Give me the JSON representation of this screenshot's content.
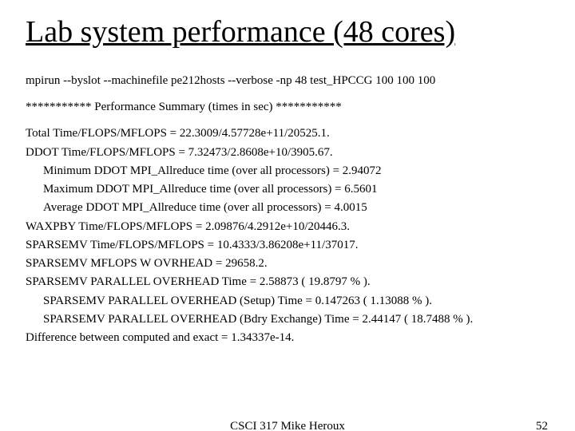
{
  "title": "Lab system performance (48 cores)",
  "cmd": "mpirun --byslot --machinefile pe212hosts --verbose -np 48 test_HPCCG 100 100 100",
  "summary_header": "*********** Performance Summary (times in sec) ***********",
  "lines": {
    "total": "Total Time/FLOPS/MFLOPS             = 22.3009/4.57728e+11/20525.1.",
    "ddot": "DDOT  Time/FLOPS/MFLOPS              = 7.32473/2.8608e+10/3905.67.",
    "ddot_min": "Minimum DDOT MPI_Allreduce time (over all processors) = 2.94072",
    "ddot_max": "Maximum DDOT MPI_Allreduce time (over all processors) = 6.5601",
    "ddot_avg": "Average DDOT MPI_Allreduce time (over all processors) = 4.0015",
    "waxpby": "WAXPBY Time/FLOPS/MFLOPS             = 2.09876/4.2912e+10/20446.3.",
    "sparsemv": "SPARSEMV Time/FLOPS/MFLOPS          = 10.4333/3.86208e+11/37017.",
    "sparsemv_wo": "SPARSEMV MFLOPS W OVRHEAD              = 29658.2.",
    "sp_ovh_time": "SPARSEMV PARALLEL OVERHEAD Time        = 2.58873 ( 19.8797 % ).",
    "sp_ovh_setup": "SPARSEMV PARALLEL OVERHEAD (Setup) Time     = 0.147263 ( 1.13088 % ).",
    "sp_ovh_bdry": "SPARSEMV PARALLEL OVERHEAD (Bdry Exchange) Time = 2.44147 ( 18.7488 % ).",
    "diff": "Difference between computed and exact  = 1.34337e-14."
  },
  "footer": {
    "center": "CSCI 317 Mike Heroux",
    "page": "52"
  }
}
